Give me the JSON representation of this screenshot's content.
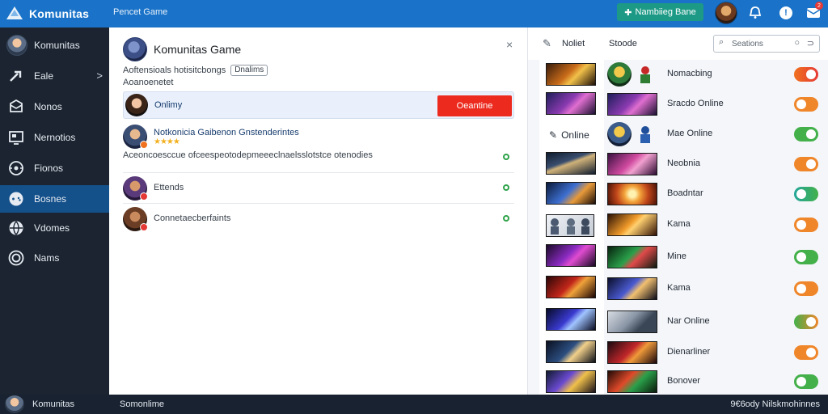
{
  "app": {
    "name": "Komunitas",
    "subtitle": "Pencet Game"
  },
  "topbar": {
    "action_label": "Nambiieg Bane",
    "info_label": "!",
    "msg_badge": "2"
  },
  "sidebar": {
    "items": [
      {
        "label": "Komunitas",
        "icon": "avatar"
      },
      {
        "label": "Eale",
        "icon": "arrow-icon",
        "chevron": ">"
      },
      {
        "label": "Nonos",
        "icon": "mail-icon"
      },
      {
        "label": "Nernotios",
        "icon": "monitor-icon"
      },
      {
        "label": "Fionos",
        "icon": "compass-icon"
      },
      {
        "label": "Bosnes",
        "icon": "gamepad-icon",
        "active": true
      },
      {
        "label": "Vdomes",
        "icon": "globe-icon"
      },
      {
        "label": "Nams",
        "icon": "target-icon"
      }
    ]
  },
  "main": {
    "title": "Komunitas Game",
    "close": "×",
    "desc": "Aoftensioals hotisitcbongs",
    "desc_chip": "Dnalims",
    "desc_sub": "Aoanoenetet",
    "online": {
      "label": "Onlimy",
      "button": "Oeantine"
    },
    "feed": [
      {
        "title": "Notkonicia Gaibenon Gnstenderintes",
        "stars": "★★★★",
        "body": "Aceoncoesccue ofceespeotodepmeeeclnaelsslotstce otenodies"
      },
      {
        "title": "Ettends"
      },
      {
        "title": "Connetaecberfaints"
      }
    ]
  },
  "right": {
    "edit_icon": "✎",
    "header_1": "Noliet",
    "header_2": "Stoode",
    "search_placeholder": "Seations",
    "online_label": "Online",
    "rows": [
      {
        "label": "Nomacbing",
        "toggle": "orange-red",
        "on": true
      },
      {
        "label": "Sracdo Online",
        "toggle": "orange",
        "on": false
      },
      {
        "label": "Mae Online",
        "toggle": "green",
        "on": true
      },
      {
        "label": "Neobnia",
        "toggle": "orange",
        "on": true
      },
      {
        "label": "Boadntar",
        "toggle": "teal",
        "on": false
      },
      {
        "label": "Kama",
        "toggle": "orange",
        "on": false
      },
      {
        "label": "Mine",
        "toggle": "green",
        "on": false
      },
      {
        "label": "Kama",
        "toggle": "orange",
        "on": false
      },
      {
        "label": "Nar Online",
        "toggle": "green-orange",
        "on": true
      },
      {
        "label": "Dienarliner",
        "toggle": "orange",
        "on": true
      },
      {
        "label": "Bonover",
        "toggle": "green",
        "on": false
      }
    ]
  },
  "status": {
    "left": "Somonlime",
    "right": "9€6ody Nilskmohinnes",
    "user": "Komunitas"
  },
  "colors": {
    "accent": "#1a73c8",
    "sidebar": "#1b2430",
    "danger": "#ec2a1e",
    "green": "#2fa34a",
    "orange": "#f0721f"
  }
}
